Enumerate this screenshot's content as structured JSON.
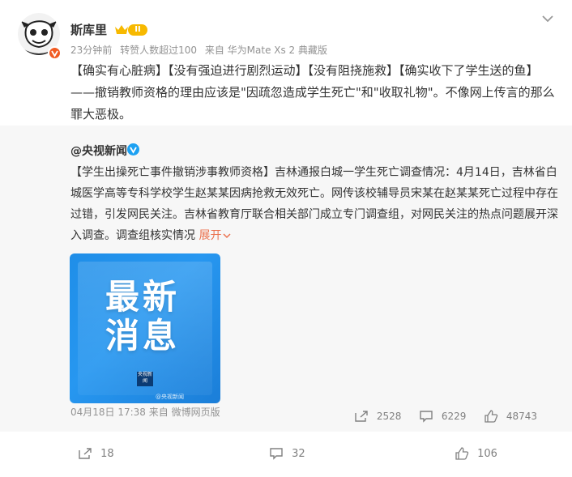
{
  "post": {
    "username": "斯库里",
    "level_badge": "II",
    "meta": {
      "time": "23分钟前",
      "reposts_info": "转赞人数超过100",
      "source": "来自 华为Mate Xs 2 典藏版"
    },
    "text": "【确实有心脏病】【没有强迫进行剧烈运动】【没有阻挠施救】【确实收下了学生送的鱼】——撤销教师资格的理由应该是\"因疏忽造成学生死亡\"和\"收取礼物\"。不像网上传言的那么罪大恶极。"
  },
  "repost": {
    "author": "@央视新闻",
    "hashtag": "【学生出操死亡事件撤销涉事教师资格】",
    "body": "吉林通报白城一学生死亡调查情况：4月14日，吉林省白城医学高等专科学校学生赵某某因病抢救无效死亡。网传该校辅导员宋某在赵某某死亡过程中存在过错，引发网民关注。吉林省教育厅联合相关部门成立专门调查组，对网民关注的热点问题展开深入调查。调查组核实情况 ",
    "expand_label": "展开",
    "image": {
      "line1": "最新",
      "line2": "消息",
      "logo": "央视新闻",
      "watermark": "@央视新闻"
    },
    "meta": "04月18日 17:38 来自 微博网页版",
    "reposts": "2528",
    "comments": "6229",
    "likes": "48743"
  },
  "footer": {
    "reposts": "18",
    "comments": "32",
    "likes": "106"
  },
  "colors": {
    "accent": "#eb7350",
    "muted": "#939393",
    "repost_bg": "#f7f7f7"
  },
  "icons": [
    "avatar",
    "verified-orange-icon",
    "crown-icon",
    "chevron-down-icon",
    "verified-blue-icon",
    "share-icon",
    "comment-icon",
    "like-icon"
  ]
}
